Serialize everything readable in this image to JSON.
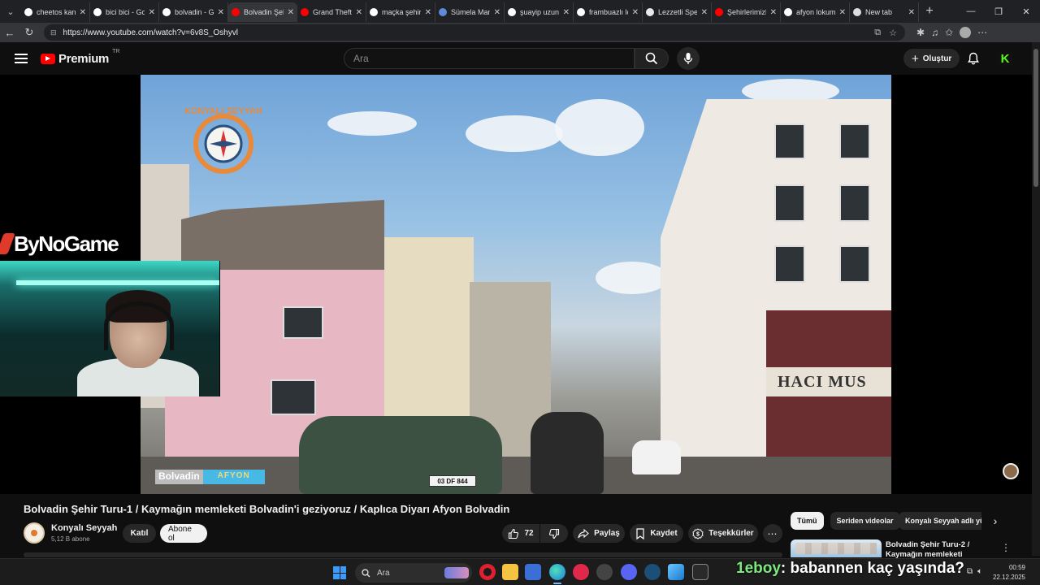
{
  "browser": {
    "tabs": [
      {
        "label": "cheetos kangu",
        "fav": "#ffffff"
      },
      {
        "label": "bici bici - Go",
        "fav": "#ffffff"
      },
      {
        "label": "bolvadin - Go",
        "fav": "#ffffff"
      },
      {
        "label": "Bolvadin Şeh",
        "fav": "#ff0000",
        "active": true
      },
      {
        "label": "Grand Theft A",
        "fav": "#ff0000"
      },
      {
        "label": "maçka şehir n",
        "fav": "#ffffff"
      },
      {
        "label": "Sümela Manas",
        "fav": "#5f8ad8"
      },
      {
        "label": "şuayip uzun",
        "fav": "#ffffff"
      },
      {
        "label": "frambuazlı lok",
        "fav": "#ffffff"
      },
      {
        "label": "Lezzetli Spesi",
        "fav": "#e8e8e8"
      },
      {
        "label": "Şehirlerimizle",
        "fav": "#ff0000"
      },
      {
        "label": "afyon lokum,",
        "fav": "#ffffff"
      },
      {
        "label": "New tab",
        "fav": "#dddddd"
      }
    ],
    "url": "https://www.youtube.com/watch?v=6v8S_Oshyvl"
  },
  "youtube": {
    "logo_text": "Premium",
    "country_code": "TR",
    "search_placeholder": "Ara",
    "create_label": "Oluştur"
  },
  "video": {
    "overlay_brand": "ByNoGame",
    "overlay_logo_text": "KONYALI SEYYAH",
    "location_label": "Bolvadin",
    "location_sub": "AFYON",
    "shop_sign": "HACI MUS",
    "plate": "03 DF 844",
    "title": "Bolvadin Şehir Turu-1 / Kaymağın memleketi Bolvadin'i geziyoruz / Kaplıca Diyarı Afyon Bolvadin",
    "channel_name": "Konyalı Seyyah",
    "subscribers": "5,12 B abone",
    "join_label": "Katıl",
    "subscribe_label": "Abone ol",
    "likes": "72",
    "share_label": "Paylaş",
    "save_label": "Kaydet",
    "thanks_label": "Teşekkürler"
  },
  "sidebar": {
    "chips": [
      "Tümü",
      "Seriden videolar",
      "Konyalı Seyyah adlı yükleyiciden"
    ],
    "rec_title": "Bolvadin Şehir Turu-2 / Kaymağın memleketi Bolvadin'"
  },
  "taskbar": {
    "search_placeholder": "Ara",
    "chat_user": "1eboy",
    "chat_message": ": babannen kaç yaşında?",
    "time": "00:59",
    "date": "22.12.2025"
  },
  "colors": {
    "accent_red": "#ff0000",
    "kick_green": "#53fc18"
  }
}
